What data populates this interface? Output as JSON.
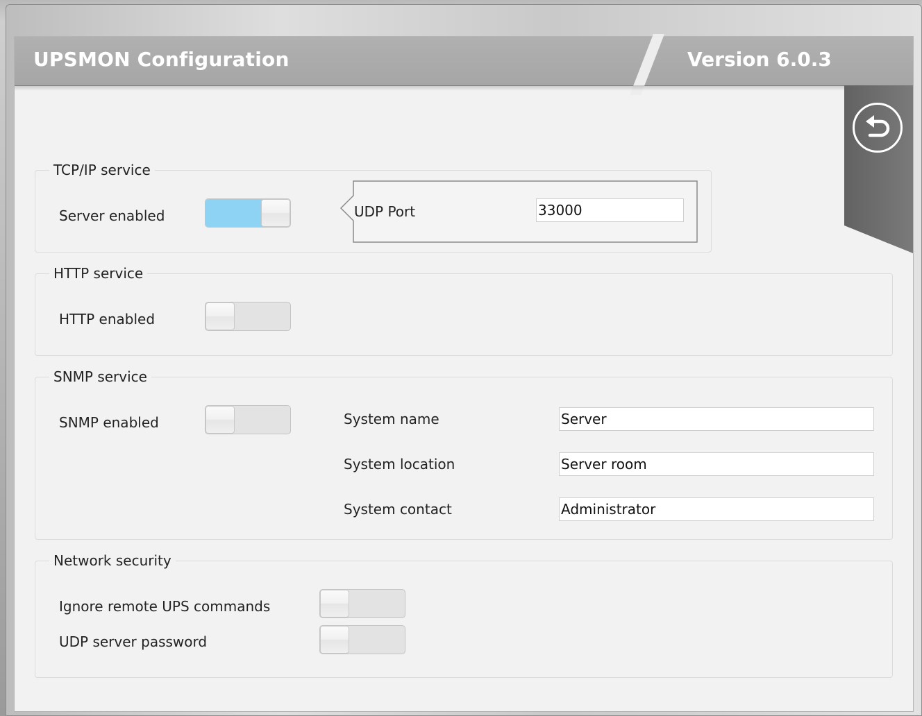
{
  "header": {
    "title": "UPSMON Configuration",
    "version": "Version 6.0.3"
  },
  "icons": {
    "back": "back-arrow-icon"
  },
  "tcpip": {
    "legend": "TCP/IP service",
    "server_enabled_label": "Server enabled",
    "server_enabled": true,
    "udp_port_label": "UDP Port",
    "udp_port_value": "33000"
  },
  "http": {
    "legend": "HTTP service",
    "http_enabled_label": "HTTP enabled",
    "http_enabled": false
  },
  "snmp": {
    "legend": "SNMP service",
    "snmp_enabled_label": "SNMP enabled",
    "snmp_enabled": false,
    "system_name_label": "System name",
    "system_name_value": "Server",
    "system_location_label": "System location",
    "system_location_value": "Server room",
    "system_contact_label": "System contact",
    "system_contact_value": "Administrator"
  },
  "security": {
    "legend": "Network security",
    "ignore_remote_label": "Ignore remote UPS commands",
    "ignore_remote": false,
    "udp_password_label": "UDP server password",
    "udp_password": false
  },
  "colors": {
    "header_bg": "#a8a8a8",
    "flag_bg": "#6e6e6e",
    "toggle_on": "#8fd3f4",
    "panel_bg": "#f2f2f2"
  }
}
